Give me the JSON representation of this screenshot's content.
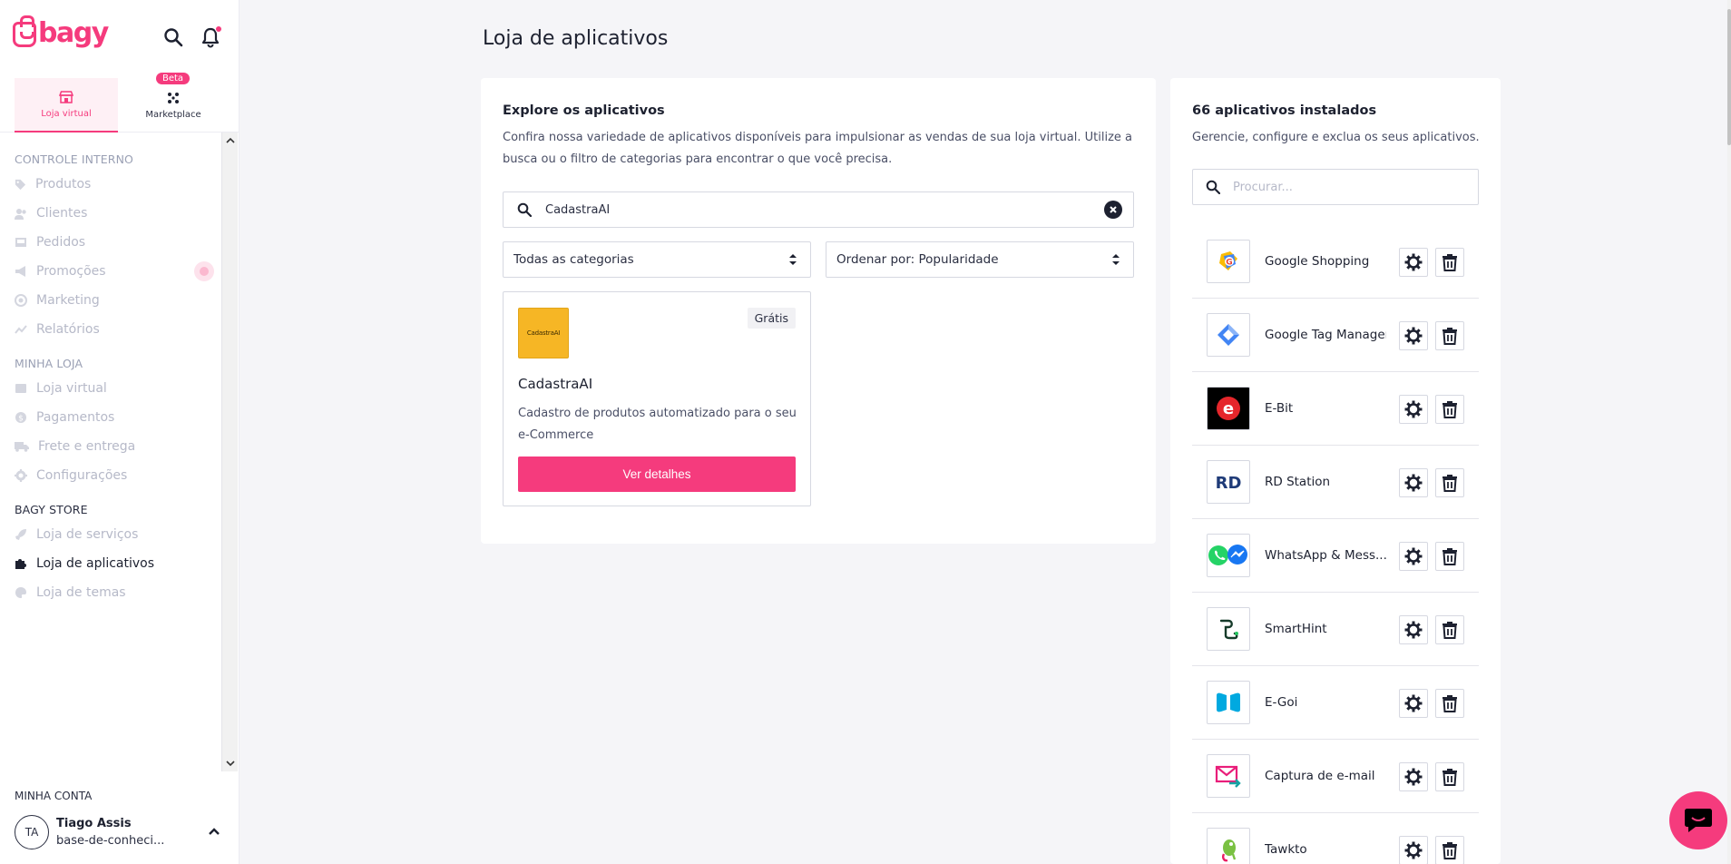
{
  "brand": {
    "logo_text": "bagy",
    "accent": "#f53b7d"
  },
  "store_tabs": [
    {
      "label": "Loja virtual",
      "icon": "storefront-icon",
      "active": true
    },
    {
      "label": "Marketplace",
      "icon": "marketplace-icon",
      "badge": "Beta",
      "active": false
    }
  ],
  "sidebar": {
    "sections": [
      {
        "title": "CONTROLE INTERNO",
        "items": [
          {
            "label": "Produtos",
            "icon": "tag-icon"
          },
          {
            "label": "Clientes",
            "icon": "users-icon"
          },
          {
            "label": "Pedidos",
            "icon": "inbox-icon"
          },
          {
            "label": "Promoções",
            "icon": "megaphone-icon"
          },
          {
            "label": "Marketing",
            "icon": "target-icon"
          },
          {
            "label": "Relatórios",
            "icon": "chart-icon"
          }
        ]
      },
      {
        "title": "MINHA LOJA",
        "items": [
          {
            "label": "Loja virtual",
            "icon": "store-icon"
          },
          {
            "label": "Pagamentos",
            "icon": "dollar-icon"
          },
          {
            "label": "Frete e entrega",
            "icon": "truck-icon"
          },
          {
            "label": "Configurações",
            "icon": "gear-icon"
          }
        ]
      },
      {
        "title": "BAGY STORE",
        "items": [
          {
            "label": "Loja de serviços",
            "icon": "rocket-icon"
          },
          {
            "label": "Loja de aplicativos",
            "icon": "puzzle-icon",
            "active": true
          },
          {
            "label": "Loja de temas",
            "icon": "palette-icon"
          }
        ]
      }
    ]
  },
  "account": {
    "title": "MINHA CONTA",
    "initials": "TA",
    "name": "Tiago Assis",
    "store": "base-de-conheci..."
  },
  "main": {
    "title": "Loja de aplicativos",
    "explore": {
      "heading": "Explore os aplicativos",
      "description": "Confira nossa variedade de aplicativos disponíveis para impulsionar as vendas de sua loja virtual. Utilize a busca ou o filtro de categorias para encontrar o que você precisa.",
      "search_value": "CadastraAI",
      "category_select": "Todas as categorias",
      "order_select": "Ordenar por: Popularidade",
      "app": {
        "logo_text": "CadastraAI",
        "price": "Grátis",
        "name": "CadastraAI",
        "description": "Cadastro de produtos automatizado para o seu e-Commerce",
        "button": "Ver detalhes"
      }
    },
    "installed": {
      "heading": "66 aplicativos instalados",
      "description": "Gerencie, configure e exclua os seus aplicativos.",
      "search_placeholder": "Procurar...",
      "apps": [
        {
          "name": "Google Shopping",
          "icon": "google-shopping-icon"
        },
        {
          "name": "Google Tag Manager",
          "icon": "google-tag-manager-icon"
        },
        {
          "name": "E-Bit",
          "icon": "ebit-icon"
        },
        {
          "name": "RD Station",
          "icon": "rd-station-icon"
        },
        {
          "name": "WhatsApp & Mess...",
          "icon": "whatsapp-messenger-icon"
        },
        {
          "name": "SmartHint",
          "icon": "smarthint-icon"
        },
        {
          "name": "E-Goi",
          "icon": "egoi-icon"
        },
        {
          "name": "Captura de e-mail",
          "icon": "email-capture-icon"
        },
        {
          "name": "Tawkto",
          "icon": "tawkto-icon"
        }
      ]
    }
  }
}
